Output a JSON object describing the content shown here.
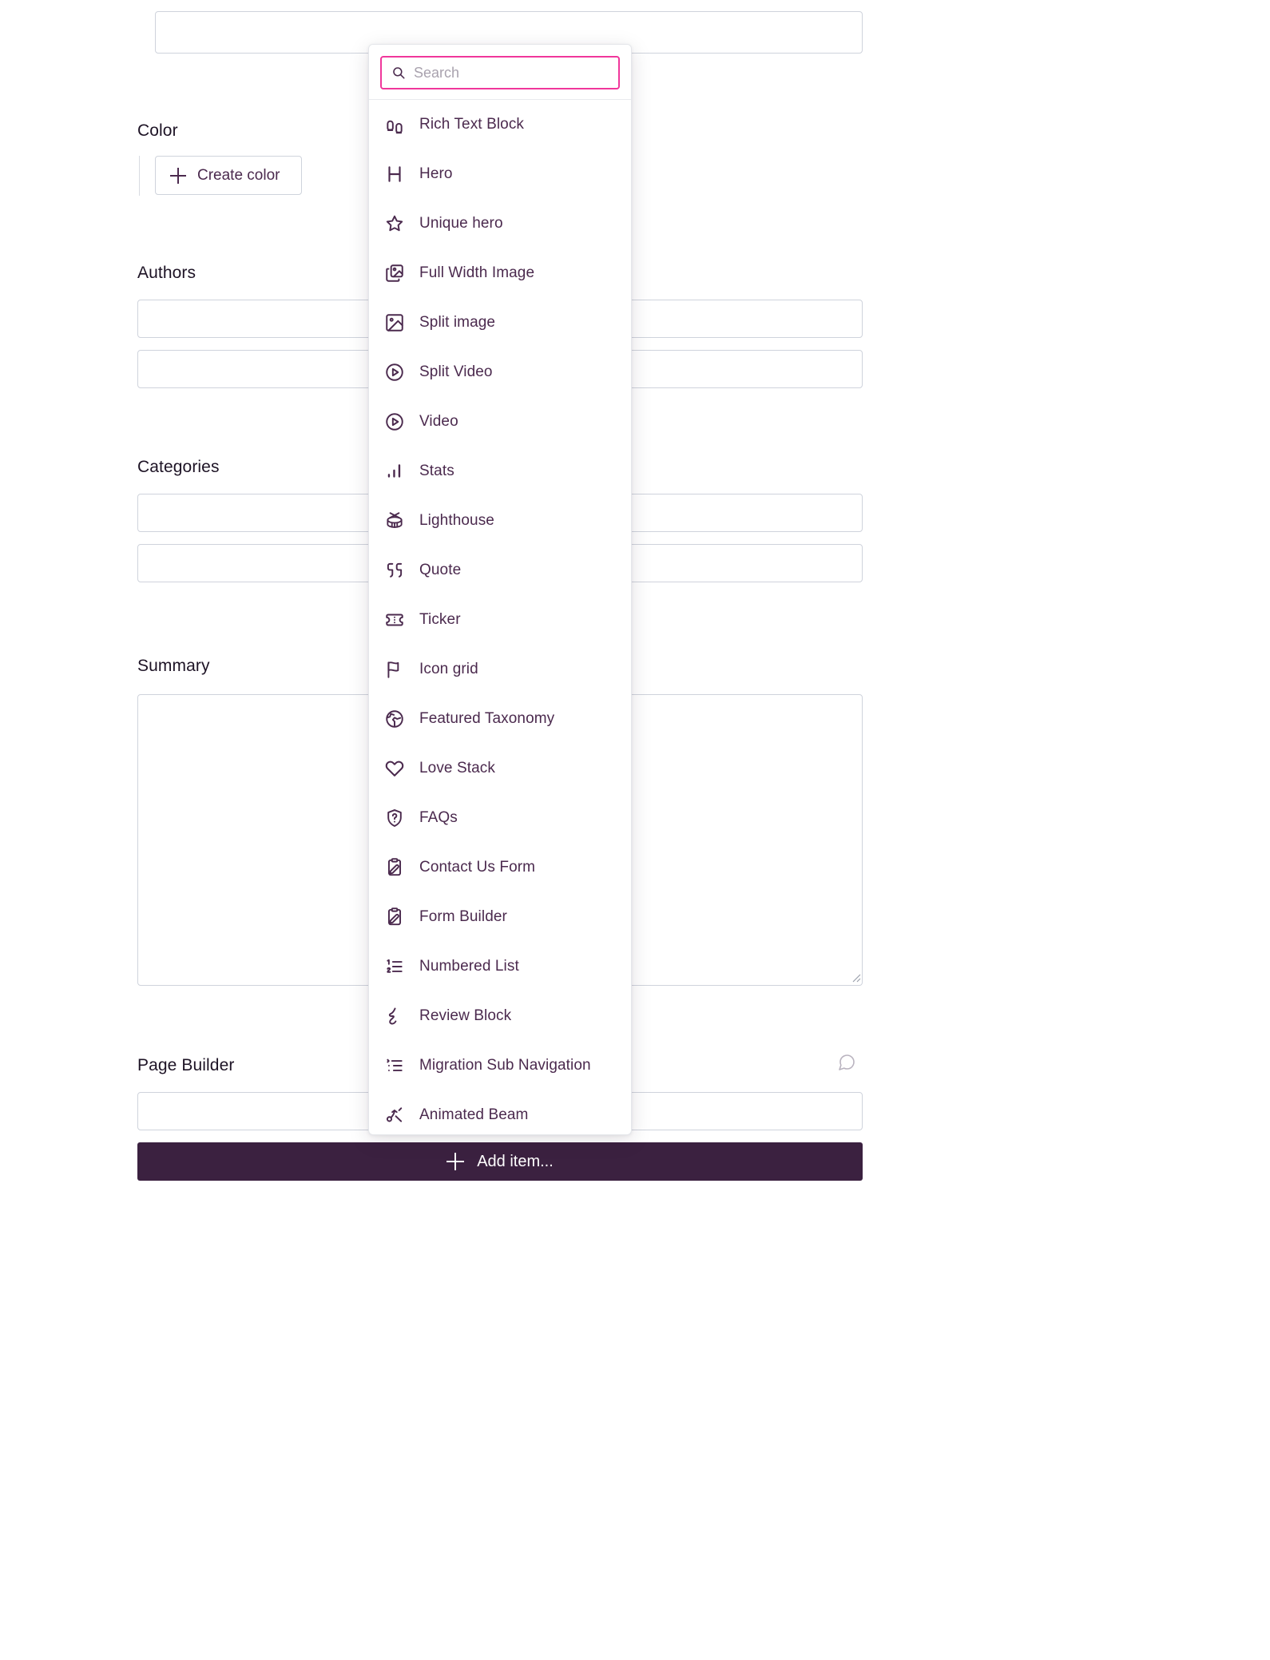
{
  "accent": {
    "icon_purple": "#4b2a4e",
    "search_border_pink": "#f0379b",
    "button_dark": "#3b2140",
    "input_border": "#cfd3dc"
  },
  "form": {
    "top_field": {
      "value": "",
      "placeholder": ""
    },
    "color": {
      "label": "Color",
      "create_button": "Create color",
      "plus_icon": "plus-icon"
    },
    "authors": {
      "label": "Authors",
      "rows": [
        {
          "value": "",
          "placeholder": ""
        },
        {
          "value": "",
          "placeholder": ""
        }
      ]
    },
    "categories": {
      "label": "Categories",
      "rows": [
        {
          "value": "",
          "placeholder": ""
        },
        {
          "value": "",
          "placeholder": ""
        }
      ]
    },
    "summary": {
      "label": "Summary",
      "value": "",
      "placeholder": ""
    },
    "page_builder": {
      "label": "Page Builder",
      "comment_icon": "comment-icon",
      "row": {
        "value": "",
        "placeholder": ""
      },
      "add_item_label": "Add item...",
      "add_item_icon": "plus-icon"
    }
  },
  "dropdown": {
    "search": {
      "placeholder": "Search",
      "value": "",
      "icon": "search-icon"
    },
    "items": [
      {
        "label": "Rich Text Block",
        "icon": "footprints-icon"
      },
      {
        "label": "Hero",
        "icon": "letter-h-icon"
      },
      {
        "label": "Unique hero",
        "icon": "star-icon"
      },
      {
        "label": "Full Width Image",
        "icon": "images-stack-icon"
      },
      {
        "label": "Split image",
        "icon": "image-icon"
      },
      {
        "label": "Split Video",
        "icon": "play-circle-icon"
      },
      {
        "label": "Video",
        "icon": "play-circle-icon"
      },
      {
        "label": "Stats",
        "icon": "bar-chart-icon"
      },
      {
        "label": "Lighthouse",
        "icon": "drum-icon"
      },
      {
        "label": "Quote",
        "icon": "quote-marks-icon"
      },
      {
        "label": "Ticker",
        "icon": "ticket-icon"
      },
      {
        "label": "Icon grid",
        "icon": "flag-icon"
      },
      {
        "label": "Featured Taxonomy",
        "icon": "globe-icon"
      },
      {
        "label": "Love Stack",
        "icon": "heart-icon"
      },
      {
        "label": "FAQs",
        "icon": "shield-question-icon"
      },
      {
        "label": "Contact Us Form",
        "icon": "clipboard-pen-icon"
      },
      {
        "label": "Form Builder",
        "icon": "clipboard-pen-icon"
      },
      {
        "label": "Numbered List",
        "icon": "ordered-list-icon"
      },
      {
        "label": "Review Block",
        "icon": "scribble-star-icon"
      },
      {
        "label": "Migration Sub Navigation",
        "icon": "list-tree-icon"
      },
      {
        "label": "Animated Beam",
        "icon": "network-nodes-icon"
      }
    ]
  }
}
